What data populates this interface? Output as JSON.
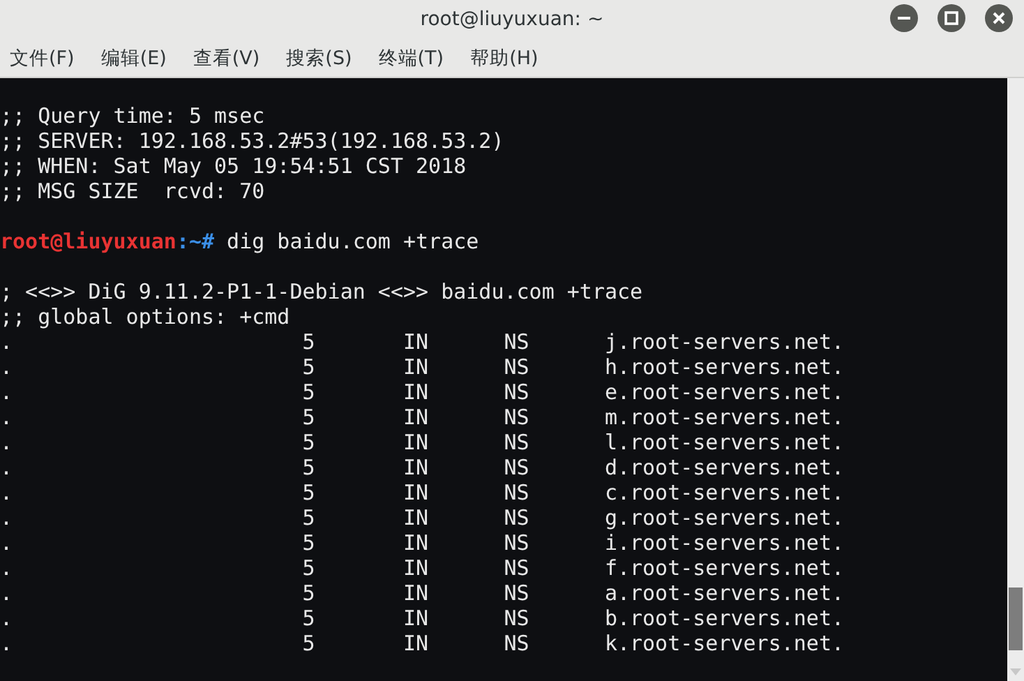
{
  "window": {
    "title": "root@liuyuxuan: ~"
  },
  "menu": [
    "文件(F)",
    "编辑(E)",
    "查看(V)",
    "搜索(S)",
    "终端(T)",
    "帮助(H)"
  ],
  "terminal": {
    "lines": [
      {
        "kind": "blank"
      },
      {
        "kind": "text",
        "text": ";; Query time: 5 msec"
      },
      {
        "kind": "text",
        "text": ";; SERVER: 192.168.53.2#53(192.168.53.2)"
      },
      {
        "kind": "text",
        "text": ";; WHEN: Sat May 05 19:54:51 CST 2018"
      },
      {
        "kind": "text",
        "text": ";; MSG SIZE  rcvd: 70"
      },
      {
        "kind": "blank"
      },
      {
        "kind": "prompt",
        "user_host": "root@liuyuxuan",
        "path": ":~#",
        "command": "dig baidu.com +trace"
      },
      {
        "kind": "blank"
      },
      {
        "kind": "text",
        "text": "; <<>> DiG 9.11.2-P1-1-Debian <<>> baidu.com +trace"
      },
      {
        "kind": "text",
        "text": ";; global options: +cmd"
      },
      {
        "kind": "record",
        "name": ".",
        "ttl": "5",
        "class": "IN",
        "type": "NS",
        "data": "j.root-servers.net."
      },
      {
        "kind": "record",
        "name": ".",
        "ttl": "5",
        "class": "IN",
        "type": "NS",
        "data": "h.root-servers.net."
      },
      {
        "kind": "record",
        "name": ".",
        "ttl": "5",
        "class": "IN",
        "type": "NS",
        "data": "e.root-servers.net."
      },
      {
        "kind": "record",
        "name": ".",
        "ttl": "5",
        "class": "IN",
        "type": "NS",
        "data": "m.root-servers.net."
      },
      {
        "kind": "record",
        "name": ".",
        "ttl": "5",
        "class": "IN",
        "type": "NS",
        "data": "l.root-servers.net."
      },
      {
        "kind": "record",
        "name": ".",
        "ttl": "5",
        "class": "IN",
        "type": "NS",
        "data": "d.root-servers.net."
      },
      {
        "kind": "record",
        "name": ".",
        "ttl": "5",
        "class": "IN",
        "type": "NS",
        "data": "c.root-servers.net."
      },
      {
        "kind": "record",
        "name": ".",
        "ttl": "5",
        "class": "IN",
        "type": "NS",
        "data": "g.root-servers.net."
      },
      {
        "kind": "record",
        "name": ".",
        "ttl": "5",
        "class": "IN",
        "type": "NS",
        "data": "i.root-servers.net."
      },
      {
        "kind": "record",
        "name": ".",
        "ttl": "5",
        "class": "IN",
        "type": "NS",
        "data": "f.root-servers.net."
      },
      {
        "kind": "record",
        "name": ".",
        "ttl": "5",
        "class": "IN",
        "type": "NS",
        "data": "a.root-servers.net."
      },
      {
        "kind": "record",
        "name": ".",
        "ttl": "5",
        "class": "IN",
        "type": "NS",
        "data": "b.root-servers.net."
      },
      {
        "kind": "record",
        "name": ".",
        "ttl": "5",
        "class": "IN",
        "type": "NS",
        "data": "k.root-servers.net."
      }
    ]
  }
}
